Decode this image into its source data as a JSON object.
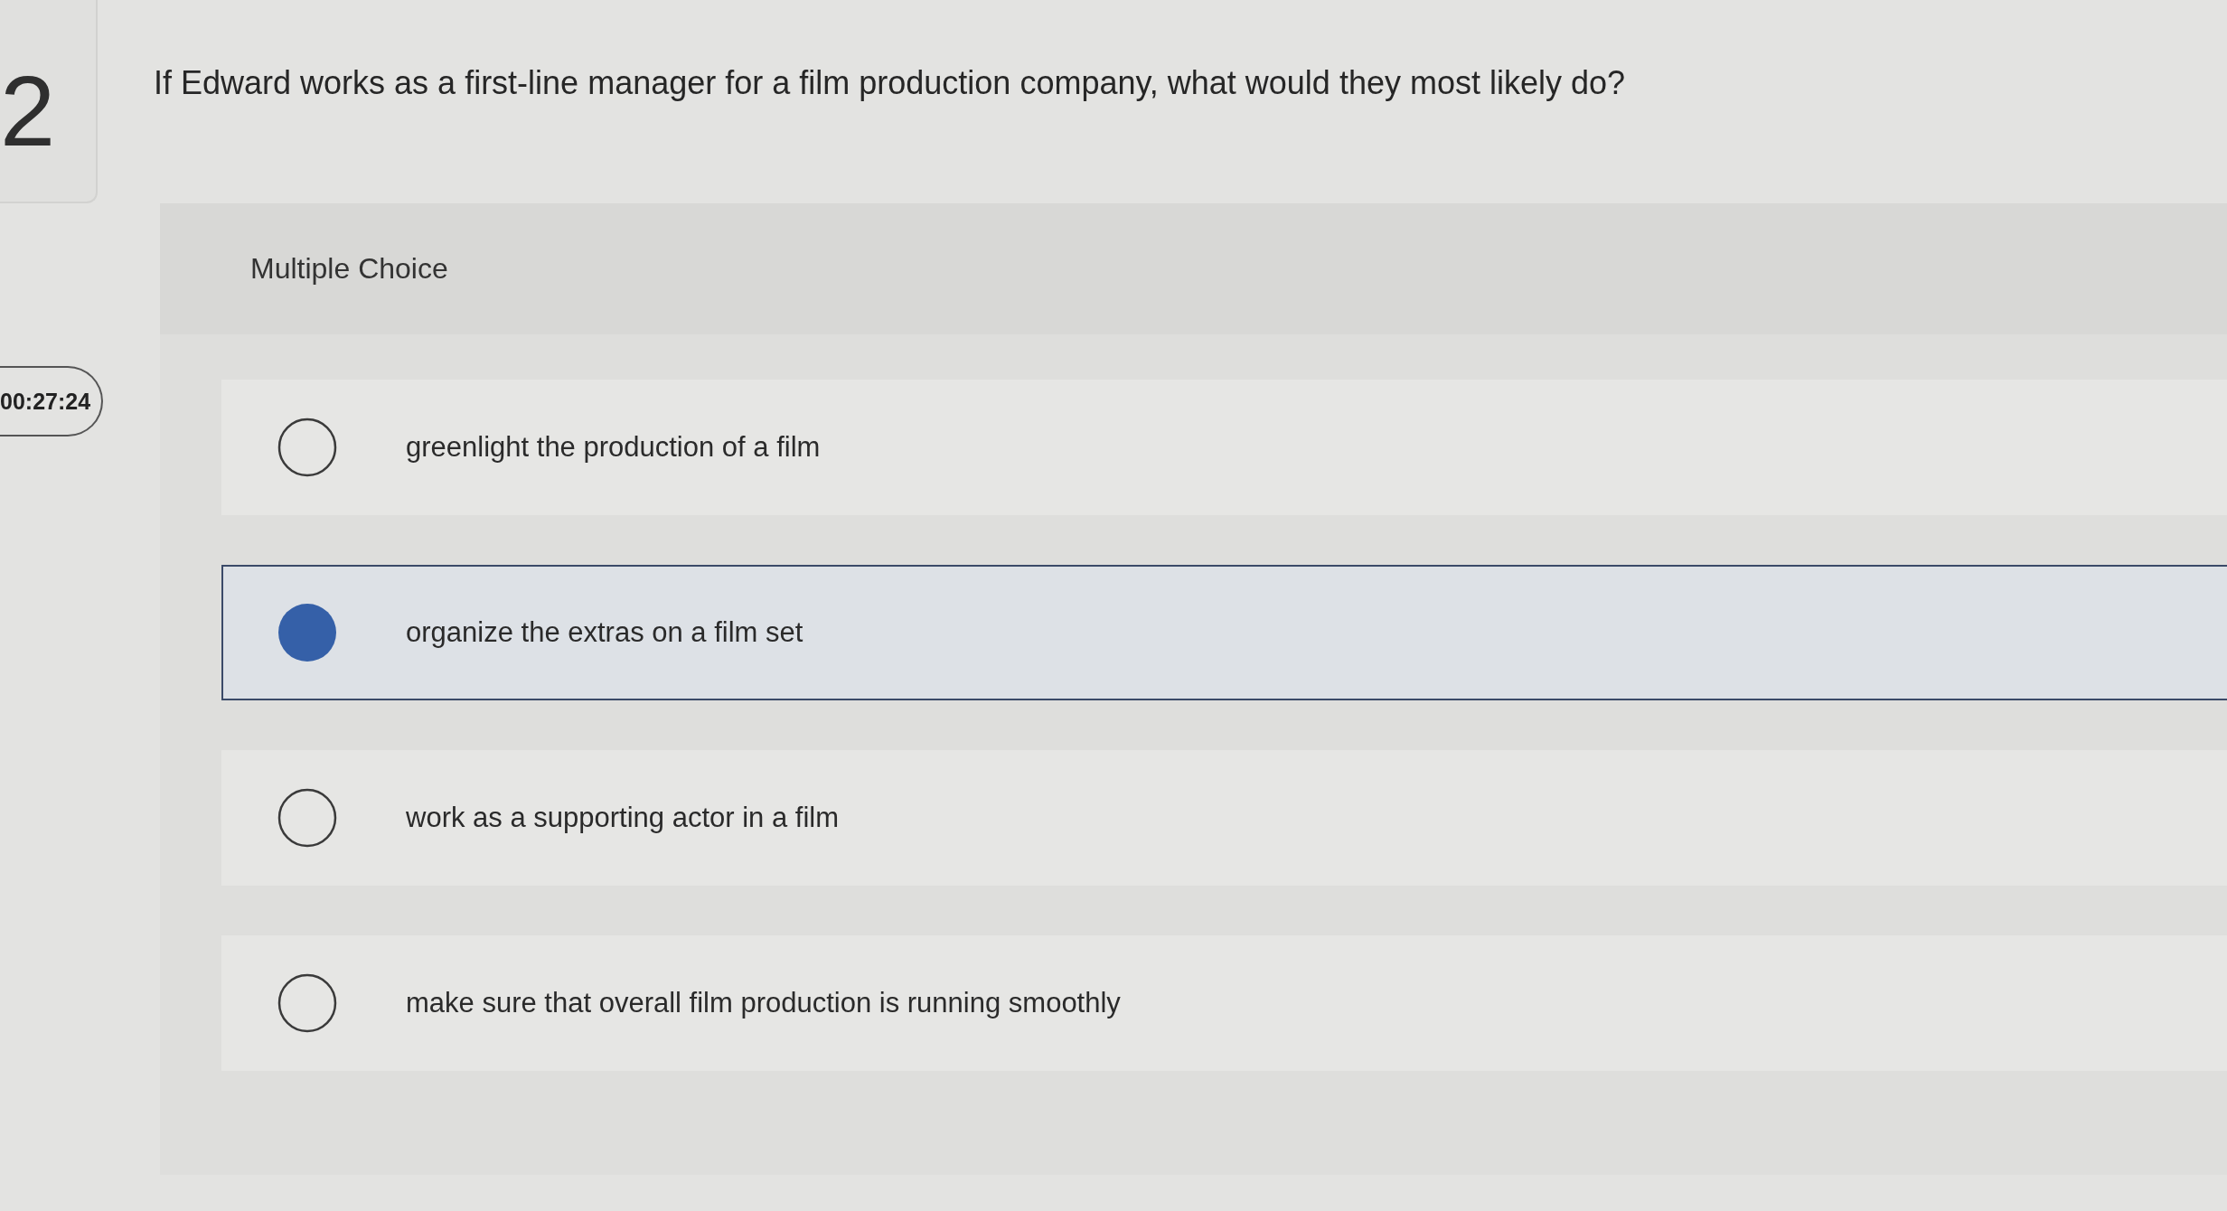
{
  "question_number": "2",
  "timer": "00:27:24",
  "question": "If Edward works as a first-line manager for a film production company, what would they most likely do?",
  "answer_type": "Multiple Choice",
  "options": [
    {
      "label": "greenlight the production of a film",
      "selected": false
    },
    {
      "label": "organize the extras on a film set",
      "selected": true
    },
    {
      "label": "work as a supporting actor in a film",
      "selected": false
    },
    {
      "label": "make sure that overall film production is running smoothly",
      "selected": false
    }
  ]
}
